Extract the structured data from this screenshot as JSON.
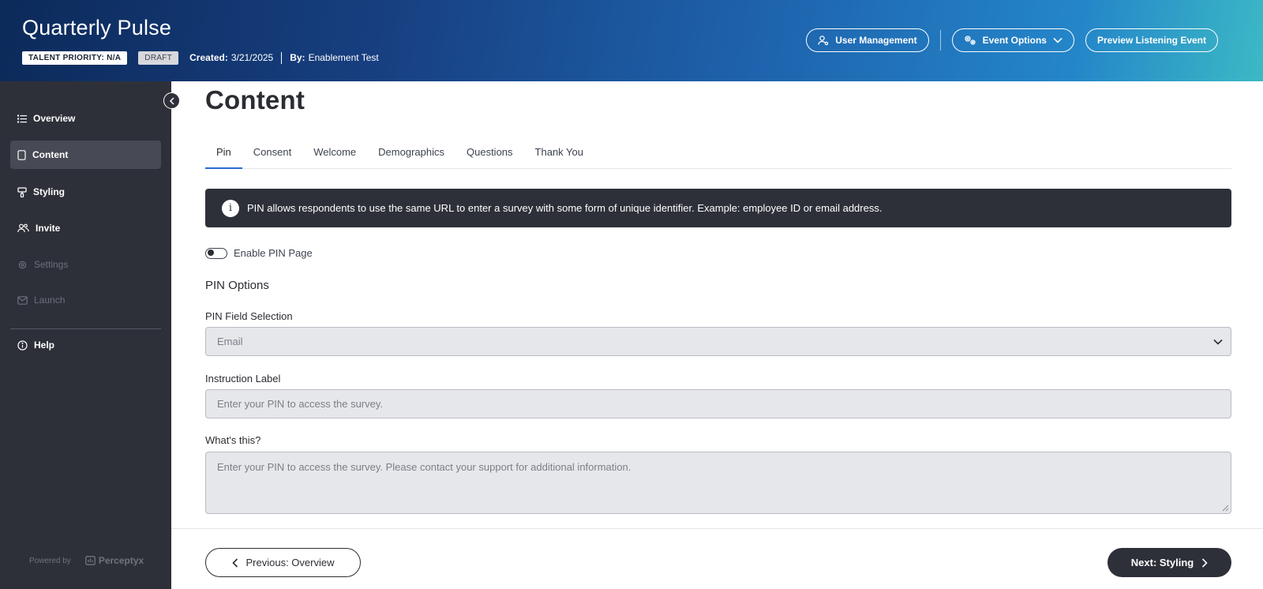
{
  "header": {
    "title": "Quarterly Pulse",
    "talent_priority": "TALENT PRIORITY: N/A",
    "status": "DRAFT",
    "created_label": "Created:",
    "created_value": "3/21/2025",
    "by_label": "By:",
    "by_value": "Enablement Test",
    "buttons": {
      "user_management": "User Management",
      "event_options": "Event Options",
      "preview": "Preview Listening Event"
    }
  },
  "sidebar": {
    "items": [
      {
        "label": "Overview",
        "icon": "list-icon"
      },
      {
        "label": "Content",
        "icon": "document-icon"
      },
      {
        "label": "Styling",
        "icon": "paint-icon"
      },
      {
        "label": "Invite",
        "icon": "people-icon"
      },
      {
        "label": "Settings",
        "icon": "gear-icon"
      },
      {
        "label": "Launch",
        "icon": "mail-icon"
      },
      {
        "label": "Help",
        "icon": "info-icon"
      }
    ],
    "active": "Content",
    "powered_by": "Powered by",
    "brand": "Perceptyx"
  },
  "main": {
    "title": "Content",
    "tabs": [
      "Pin",
      "Consent",
      "Welcome",
      "Demographics",
      "Questions",
      "Thank You"
    ],
    "active_tab": "Pin",
    "banner_text": "PIN allows respondents to use the same URL to enter a survey with some form of unique identifier. Example: employee ID or email address.",
    "toggle_label": "Enable PIN Page",
    "section_title": "PIN Options",
    "fields": {
      "pin_field_label": "PIN Field Selection",
      "pin_field_value": "Email",
      "instruction_label": "Instruction Label",
      "instruction_placeholder": "Enter your PIN to access the survey.",
      "whats_this_label": "What's this?",
      "whats_this_placeholder": "Enter your PIN to access the survey. Please contact your support for additional information."
    }
  },
  "footer": {
    "previous": "Previous: Overview",
    "next": "Next: Styling"
  },
  "colors": {
    "sidebar_bg": "#2e3039",
    "active_tab": "#2a6ccf",
    "field_bg": "#e6e7ea"
  }
}
